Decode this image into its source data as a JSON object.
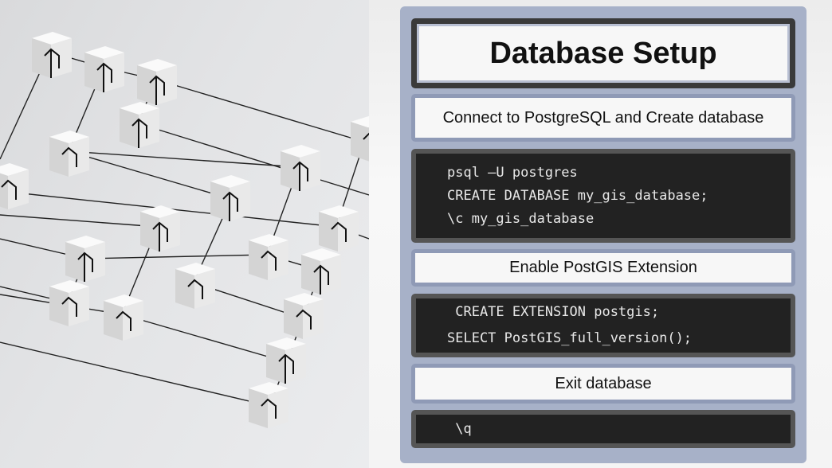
{
  "title": "Database Setup",
  "sections": [
    {
      "heading": "Connect to PostgreSQL and Create database",
      "code": [
        "psql –U postgres",
        "CREATE DATABASE my_gis_database;",
        "\\c my_gis_database"
      ]
    },
    {
      "heading": "Enable PostGIS Extension",
      "code": [
        " CREATE EXTENSION postgis;",
        "SELECT PostGIS_full_version();"
      ]
    },
    {
      "heading": "Exit database",
      "code": [
        " \\q"
      ]
    }
  ],
  "colors": {
    "panel": "#a7b1c8",
    "code_bg": "#222222",
    "title_border": "#3a3a3a"
  },
  "icons": [
    "network-blocks-illustration"
  ]
}
